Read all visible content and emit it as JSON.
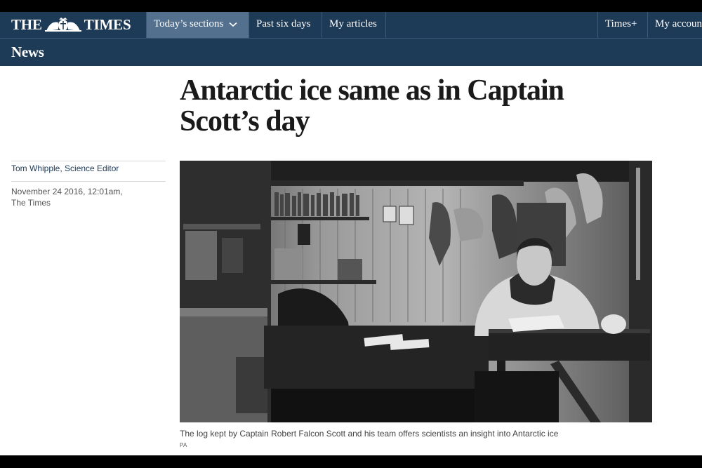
{
  "masthead": {
    "logo_left": "THE",
    "logo_right": "TIMES",
    "nav": [
      {
        "label": "Today’s sections",
        "active": true
      },
      {
        "label": "Past six days"
      },
      {
        "label": "My articles"
      }
    ],
    "right_nav": [
      {
        "label": "Times+"
      },
      {
        "label": "My account"
      }
    ]
  },
  "section": {
    "label": "News"
  },
  "article": {
    "headline": "Antarctic ice same as in Captain Scott’s day",
    "author": "Tom Whipple, Science Editor",
    "date": "November 24 2016, 12:01am,",
    "publication": "The Times",
    "image_caption": "The log kept by Captain Robert Falcon Scott and his team offers scientists an insight into Antarctic ice",
    "image_credit": "PA"
  },
  "colors": {
    "masthead_bg": "#1d3a57",
    "active_tab_bg": "#53718f",
    "author_link": "#1d3a57"
  },
  "icons": {
    "crest": "royal-crest-icon",
    "dropdown": "chevron-down-icon"
  }
}
